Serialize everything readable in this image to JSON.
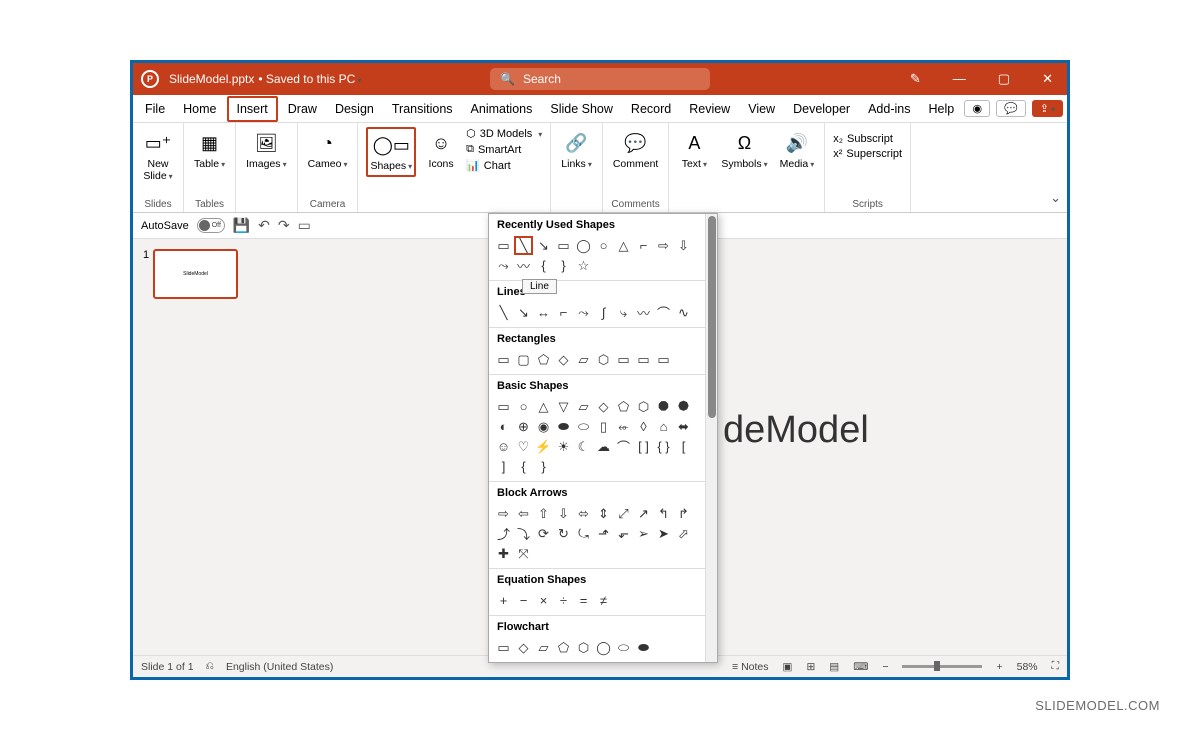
{
  "titlebar": {
    "filename": "SlideModel.pptx",
    "saved": "• Saved to this PC",
    "search_placeholder": "Search"
  },
  "tabs": [
    "File",
    "Home",
    "Insert",
    "Draw",
    "Design",
    "Transitions",
    "Animations",
    "Slide Show",
    "Record",
    "Review",
    "View",
    "Developer",
    "Add-ins",
    "Help"
  ],
  "ribbon": {
    "slides": {
      "new_slide": "New\nSlide",
      "group": "Slides"
    },
    "tables": {
      "table": "Table",
      "group": "Tables"
    },
    "images": {
      "images": "Images"
    },
    "camera": {
      "cameo": "Cameo",
      "group": "Camera"
    },
    "shapes": "Shapes",
    "icons": "Icons",
    "models3d": "3D Models",
    "smartart": "SmartArt",
    "chart": "Chart",
    "links": "Links",
    "comment": "Comment",
    "comments_group": "Comments",
    "text": "Text",
    "symbols": "Symbols",
    "media": "Media",
    "subscript": "Subscript",
    "superscript": "Superscript",
    "scripts_group": "Scripts"
  },
  "autosave": {
    "label": "AutoSave",
    "state": "Off"
  },
  "dropdown": {
    "recently_used": "Recently Used Shapes",
    "lines": "Lines",
    "rectangles": "Rectangles",
    "basic": "Basic Shapes",
    "block_arrows": "Block Arrows",
    "equation": "Equation Shapes",
    "flowchart": "Flowchart",
    "tooltip": "Line"
  },
  "slide_text": "deModel",
  "thumbnail_text": "SlideModel",
  "status": {
    "slide": "Slide 1 of 1",
    "lang": "English (United States)",
    "notes": "Notes",
    "zoom": "58%"
  },
  "watermark": "SLIDEMODEL.COM"
}
